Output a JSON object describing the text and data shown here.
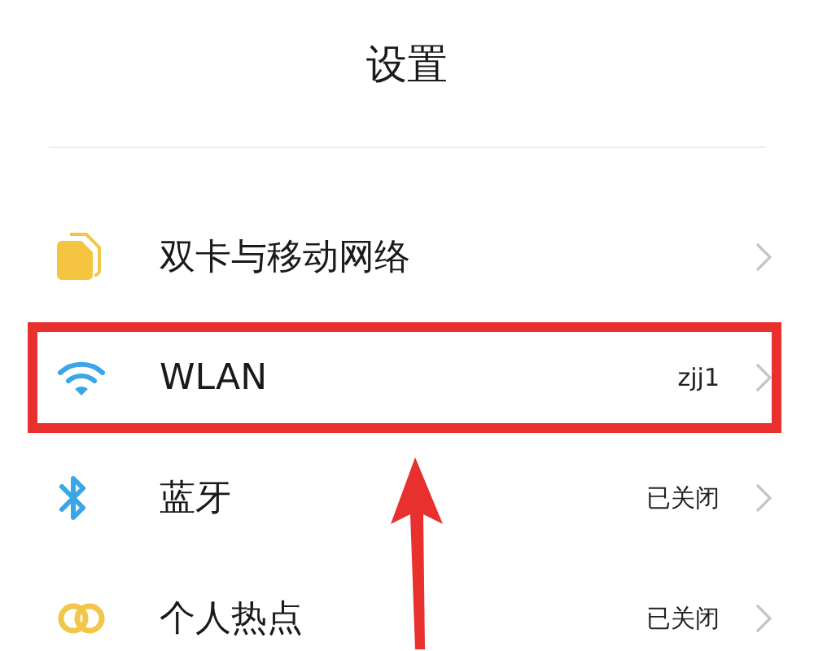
{
  "header": {
    "title": "设置"
  },
  "items": [
    {
      "kind": "sim",
      "label": "双卡与移动网络",
      "highlighted": false
    },
    {
      "kind": "wifi",
      "label": "WLAN",
      "value": "zjj1",
      "highlighted": true
    },
    {
      "kind": "bluetooth",
      "label": "蓝牙",
      "value": "已关闭",
      "highlighted": false
    },
    {
      "kind": "hotspot",
      "label": "个人热点",
      "value": "已关闭",
      "highlighted": false
    }
  ]
}
